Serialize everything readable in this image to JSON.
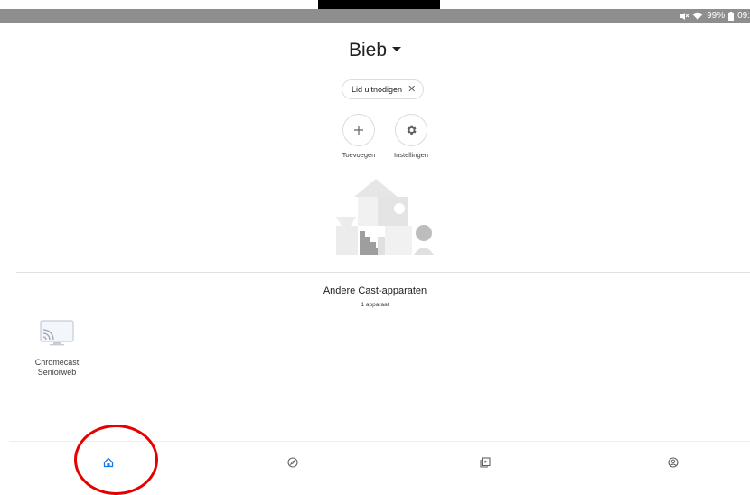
{
  "status_bar": {
    "battery": "99%",
    "time": "09:"
  },
  "header": {
    "title": "Bieb"
  },
  "chip": {
    "label": "Lid uitnodigen"
  },
  "actions": [
    {
      "label": "Toevoegen",
      "icon": "plus-icon"
    },
    {
      "label": "Instellingen",
      "icon": "gear-icon"
    }
  ],
  "section": {
    "title": "Andere Cast-apparaten",
    "subtitle": "1 apparaat"
  },
  "devices": [
    {
      "name_line1": "Chromecast",
      "name_line2": "Seniorweb",
      "icon": "cast-tv-icon"
    }
  ],
  "bottom_nav": [
    {
      "icon": "home-icon",
      "active": true
    },
    {
      "icon": "compass-icon",
      "active": false
    },
    {
      "icon": "media-icon",
      "active": false
    },
    {
      "icon": "account-icon",
      "active": false
    }
  ],
  "colors": {
    "accent": "#1a73e8",
    "annotation": "#e60000",
    "status_bar": "#8e8e8e"
  }
}
